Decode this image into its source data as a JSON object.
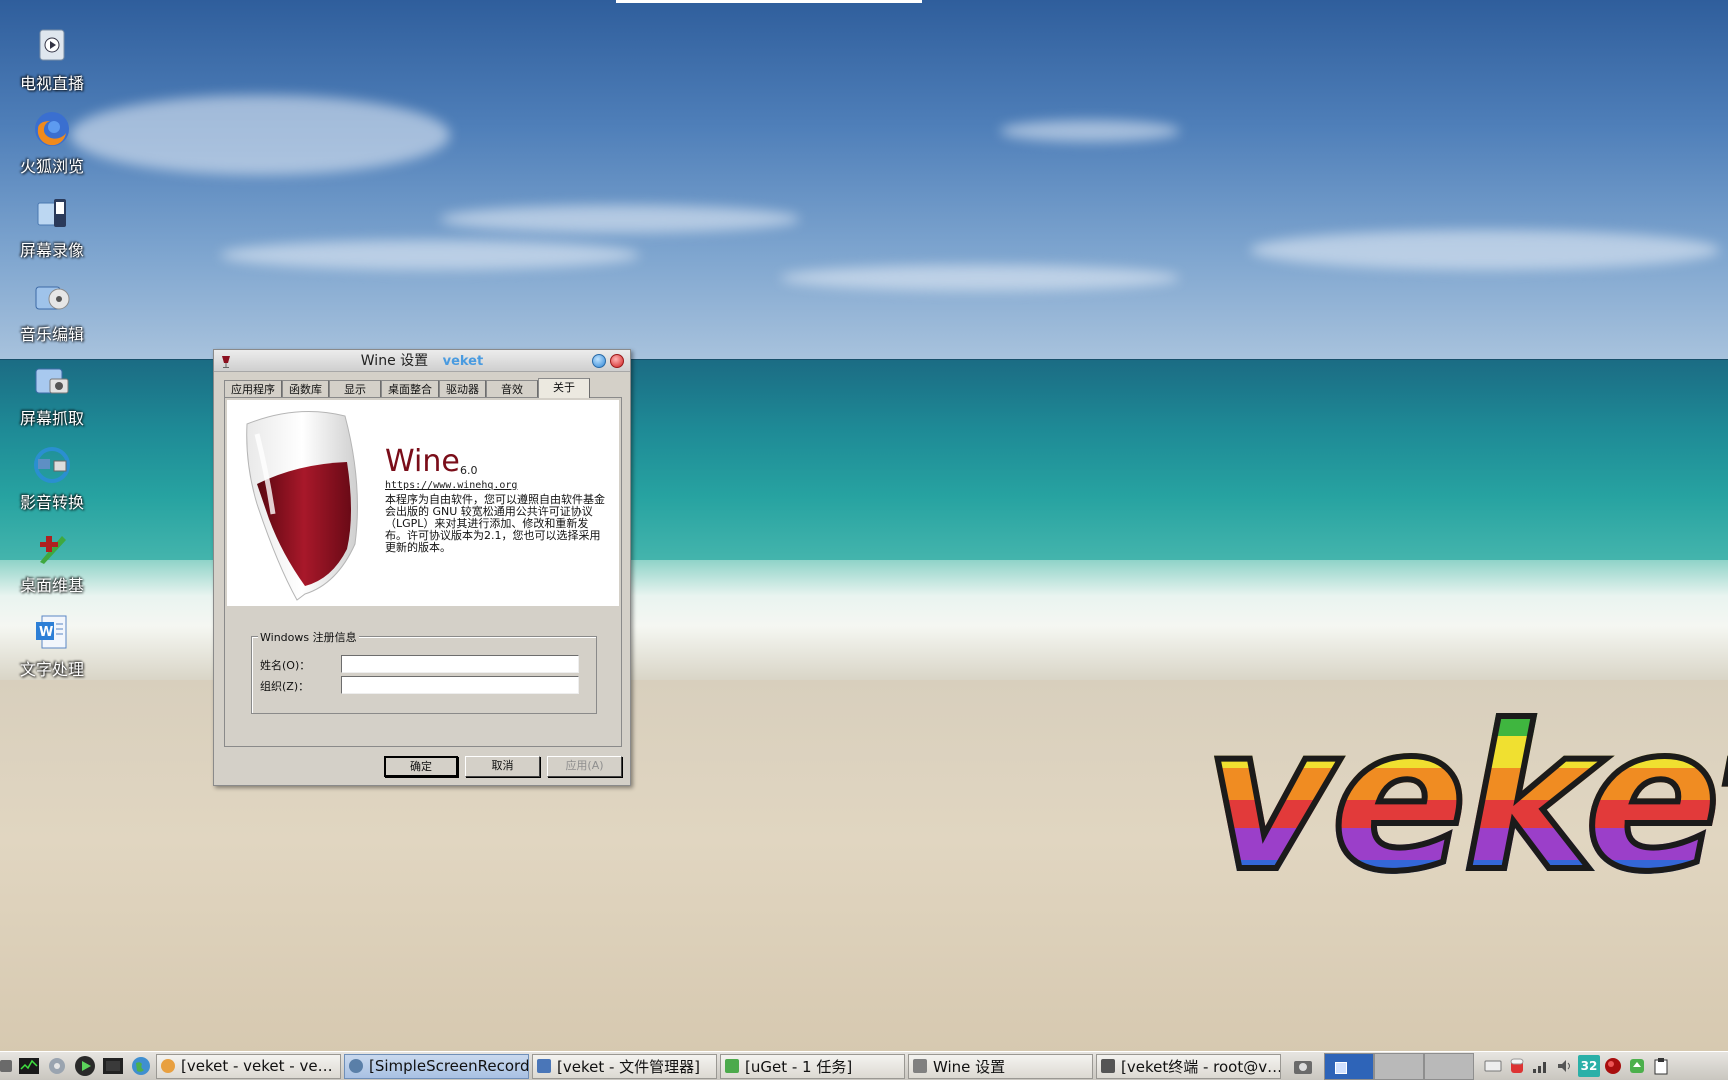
{
  "desktop_icons": [
    {
      "label": "电视直播",
      "icon": "tv-live-icon"
    },
    {
      "label": "火狐浏览",
      "icon": "firefox-icon"
    },
    {
      "label": "屏幕录像",
      "icon": "screen-record-icon"
    },
    {
      "label": "音乐编辑",
      "icon": "music-edit-icon"
    },
    {
      "label": "屏幕抓取",
      "icon": "screenshot-icon"
    },
    {
      "label": "影音转换",
      "icon": "media-convert-icon"
    },
    {
      "label": "桌面维基",
      "icon": "desktop-wiki-icon"
    },
    {
      "label": "文字处理",
      "icon": "word-processor-icon"
    }
  ],
  "wallpaper_logo": "veket",
  "wine_window": {
    "title": "Wine 设置",
    "wm_tag": "veket",
    "tabs": [
      "应用程序",
      "函数库",
      "显示",
      "桌面整合",
      "驱动器",
      "音效",
      "关于"
    ],
    "active_tab": "关于",
    "about": {
      "name": "Wine",
      "version": "6.0",
      "url": "https://www.winehq.org",
      "license_text": "本程序为自由软件，您可以遵照自由软件基金会出版的 GNU 较宽松通用公共许可证协议（LGPL）来对其进行添加、修改和重新发布。许可协议版本为2.1，您也可以选择采用更新的版本。"
    },
    "registration": {
      "legend": "Windows 注册信息",
      "owner_label": "姓名(O)：",
      "owner_value": "",
      "org_label": "组织(Z)：",
      "org_value": ""
    },
    "buttons": {
      "ok": "确定",
      "cancel": "取消",
      "apply": "应用(A)"
    }
  },
  "taskbar": {
    "tasks": [
      {
        "label": "[veket - veket - ve…",
        "icon_color": "#e8a040",
        "active": false
      },
      {
        "label": "[SimpleScreenRecorder]",
        "icon_color": "#5a7fa8",
        "active": true
      },
      {
        "label": "[veket - 文件管理器]",
        "icon_color": "#4a76b8",
        "active": false
      },
      {
        "label": "[uGet - 1 任务]",
        "icon_color": "#4caa4c",
        "active": false
      },
      {
        "label": "Wine 设置",
        "icon_color": "#808080",
        "active": false
      },
      {
        "label": "[veket终端 - root@v…",
        "icon_color": "#555555",
        "active": false
      }
    ],
    "tray_temp": "32"
  }
}
